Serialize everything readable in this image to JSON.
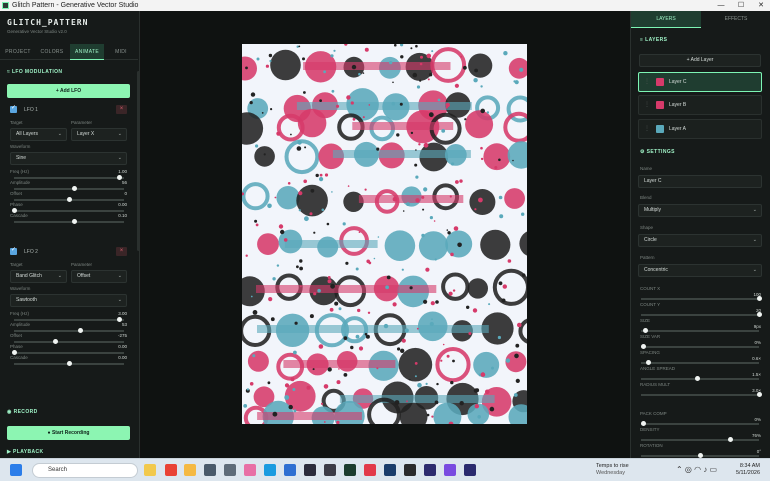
{
  "window": {
    "title": "Glitch Pattern - Generative Vector Studio",
    "controls": [
      "—",
      "☐",
      "✕"
    ]
  },
  "app": {
    "title": "GLITCH_PATTERN",
    "subtitle": "Generative Vector Studio v2.0"
  },
  "left_tabs": [
    {
      "label": "PROJECT"
    },
    {
      "label": "COLORS"
    },
    {
      "label": "ANIMATE"
    },
    {
      "label": "MIDI"
    }
  ],
  "lfo_section": {
    "title": "LFO MODULATION",
    "add_label": "+ Add LFO"
  },
  "lfos": [
    {
      "name": "LFO 1",
      "target_label": "Target",
      "target": "All Layers",
      "param_label": "Parameter",
      "param": "Layer X",
      "waveform_label": "Waveform",
      "waveform": "Sine",
      "sliders": [
        {
          "label": "Freq (Hz)",
          "value": "1.00",
          "fraction": 0.96
        },
        {
          "label": "Amplitude",
          "value": "56",
          "fraction": 0.55
        },
        {
          "label": "Offset",
          "value": "0",
          "fraction": 0.5
        },
        {
          "label": "Phase",
          "value": "0.00",
          "fraction": 0.0
        },
        {
          "label": "Cascade",
          "value": "0.10",
          "fraction": 0.55
        }
      ]
    },
    {
      "name": "LFO 2",
      "target_label": "Target",
      "target": "Band Glitch",
      "param_label": "Parameter",
      "param": "Offset",
      "waveform_label": "Waveform",
      "waveform": "Sawtooth",
      "sliders": [
        {
          "label": "Freq (Hz)",
          "value": "3.00",
          "fraction": 0.96
        },
        {
          "label": "Amplitude",
          "value": "53",
          "fraction": 0.6
        },
        {
          "label": "Offset",
          "value": "-275",
          "fraction": 0.38
        },
        {
          "label": "Phase",
          "value": "0.00",
          "fraction": 0.0
        },
        {
          "label": "Cascade",
          "value": "0.00",
          "fraction": 0.5
        }
      ]
    }
  ],
  "record": {
    "title": "RECORD",
    "button": "● Start Recording"
  },
  "playback": {
    "title": "PLAYBACK"
  },
  "right_tabs": [
    {
      "label": "LAYERS"
    },
    {
      "label": "EFFECTS"
    }
  ],
  "layers_section": {
    "title": "LAYERS",
    "add_label": "+ Add Layer",
    "items": [
      {
        "name": "Layer C",
        "color": "#d63a6a"
      },
      {
        "name": "Layer B",
        "color": "#d63a6a"
      },
      {
        "name": "Layer A",
        "color": "#5aa9bb"
      }
    ]
  },
  "settings": {
    "title": "SETTINGS",
    "name_label": "Name",
    "name_value": "Layer C",
    "blend_label": "Blend",
    "blend": "Multiply",
    "shape_label": "Shape",
    "shape": "Circle",
    "pattern_label": "Pattern",
    "pattern": "Concentric",
    "sliders": [
      {
        "label": "COUNT X",
        "value": "100",
        "fraction": 1.0
      },
      {
        "label": "COUNT Y",
        "value": "20",
        "fraction": 1.0
      },
      {
        "label": "SIZE",
        "value": "9px",
        "fraction": 0.04
      },
      {
        "label": "SIZE VAR",
        "value": "0%",
        "fraction": 0.02
      },
      {
        "label": "SPACING",
        "value": "0.6×",
        "fraction": 0.06
      },
      {
        "label": "ANGLE SPREAD",
        "value": "1.5×",
        "fraction": 0.48
      },
      {
        "label": "RADIUS MULT",
        "value": "3.0×",
        "fraction": 1.0
      },
      {
        "label": "PACK COMP",
        "value": "0%",
        "fraction": 0.02
      },
      {
        "label": "DENSITY",
        "value": "76%",
        "fraction": 0.76
      },
      {
        "label": "ROTATION",
        "value": "0°",
        "fraction": 0.5
      }
    ]
  },
  "taskbar": {
    "search_placeholder": "Search",
    "weather_line1": "Temps to rise",
    "weather_line2": "Wednesday",
    "time": "8:34 AM",
    "date": "5/11/2026"
  },
  "colors": {
    "accent": "#7df5b4",
    "pink": "#d63a6a",
    "teal": "#5aa9bb",
    "dark": "#222222"
  }
}
